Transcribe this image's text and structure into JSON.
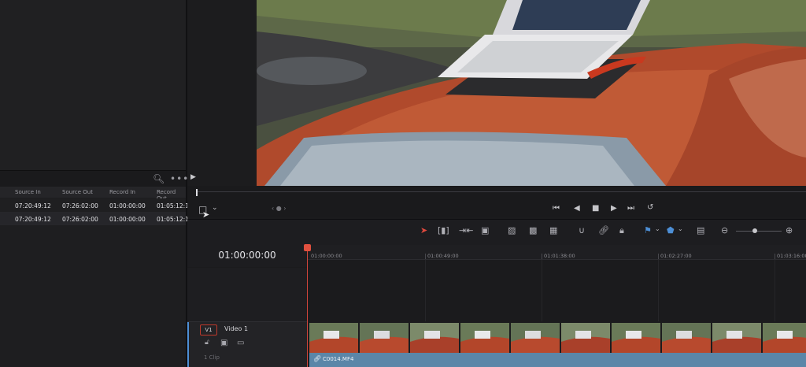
{
  "edit_index": {
    "columns": [
      "Source In",
      "Source Out",
      "Record In",
      "Record Out"
    ],
    "rows": [
      [
        "07:20:49:12",
        "07:26:02:00",
        "01:00:00:00",
        "01:05:12:1"
      ],
      [
        "07:20:49:12",
        "07:26:02:00",
        "01:00:00:00",
        "01:05:12:1"
      ]
    ]
  },
  "viewer": {
    "scene_description": "Laptop on top of a red car roof"
  },
  "timeline": {
    "timecode": "01:00:00:00",
    "ruler_labels": [
      "01:00:00:00",
      "01:00:49:00",
      "01:01:38:00",
      "01:02:27:00",
      "01:03:16:00"
    ],
    "track": {
      "badge": "V1",
      "name": "Video 1",
      "clip_count": "1 Clip",
      "clip_name": "C0014.MF4"
    }
  },
  "colors": {
    "playhead": "#d2453b",
    "clip_bar": "#5b86a8",
    "accent_blue": "#4d8fd6"
  },
  "icons": {
    "search": "search-icon",
    "more": "more-icon",
    "transform": "transform-icon",
    "snapping": "magnet-icon",
    "link": "link-icon",
    "lock": "lock-icon",
    "flag": "flag-icon",
    "marker": "marker-icon"
  }
}
